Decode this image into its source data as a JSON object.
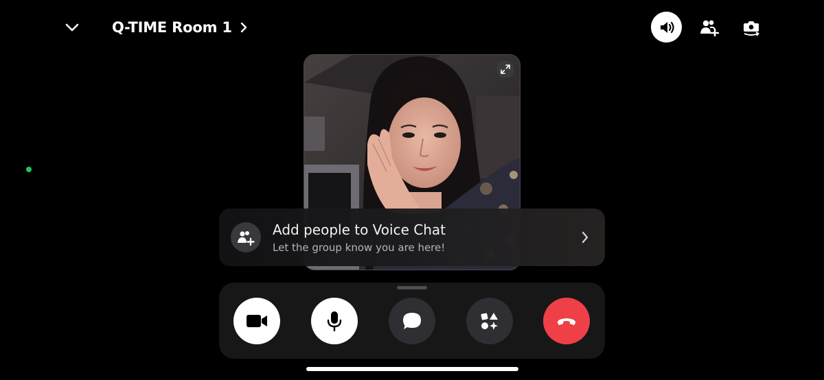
{
  "header": {
    "room_title": "Q-TIME Room 1",
    "icons": [
      "chevron-down-icon",
      "chevron-right-icon",
      "speaker-icon",
      "add-person-icon",
      "camera-flip-icon"
    ]
  },
  "video_tile": {
    "icons": [
      "expand-icon"
    ]
  },
  "invite_banner": {
    "title": "Add people to Voice Chat",
    "subtitle": "Let the group know you are here!",
    "icons": [
      "add-people-icon",
      "chevron-right-icon"
    ]
  },
  "controls": {
    "buttons": [
      {
        "name": "camera",
        "icon": "video-camera-icon"
      },
      {
        "name": "microphone",
        "icon": "microphone-icon"
      },
      {
        "name": "chat",
        "icon": "chat-bubble-icon"
      },
      {
        "name": "activities",
        "icon": "activities-icon"
      },
      {
        "name": "end-call",
        "icon": "hang-up-icon"
      }
    ]
  },
  "colors": {
    "background": "#000000",
    "end_call": "#ee4046",
    "status_online": "#23c55e",
    "control_bar": "#171718"
  }
}
